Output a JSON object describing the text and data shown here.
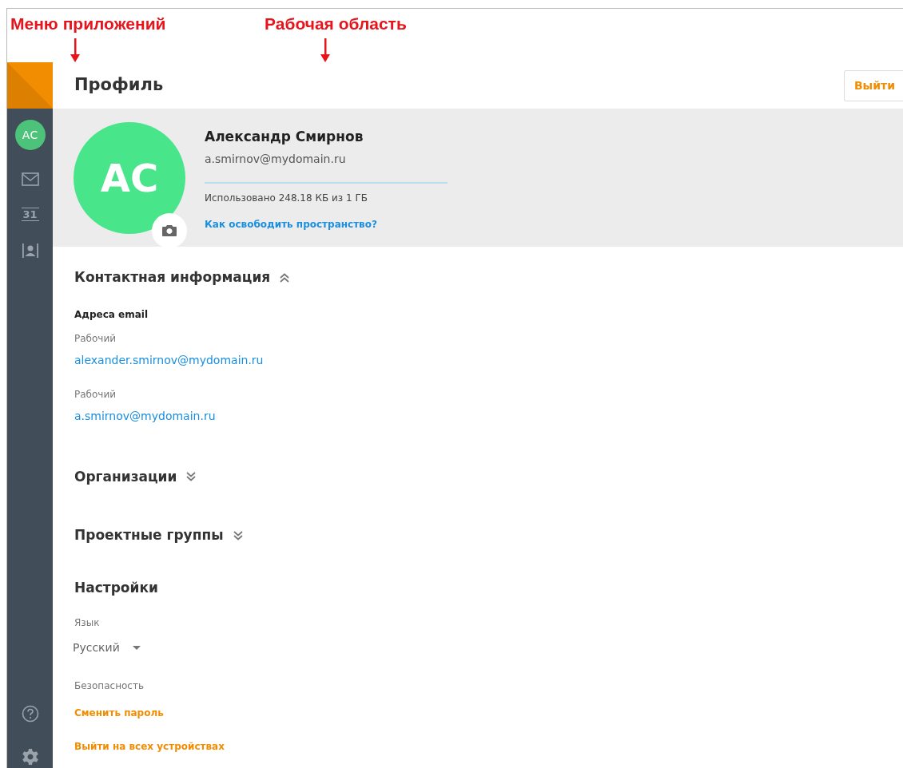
{
  "annotations": [
    {
      "label": "Меню приложений"
    },
    {
      "label": "Рабочая область"
    }
  ],
  "sidebar": {
    "items": [
      {
        "kind": "avatar",
        "initials": "АС"
      },
      {
        "kind": "mail"
      },
      {
        "kind": "calendar",
        "label": "31"
      },
      {
        "kind": "contacts"
      }
    ],
    "bottom_items": [
      {
        "kind": "help"
      },
      {
        "kind": "settings"
      }
    ]
  },
  "header": {
    "title": "Профиль",
    "logout_button": "Выйти"
  },
  "profile": {
    "initials": "АС",
    "name": "Александр Смирнов",
    "email": "a.smirnov@mydomain.ru",
    "storage": {
      "level": 0,
      "text": "Использовано 248.18 КБ из 1 ГБ"
    },
    "free_space_link": "Как освободить пространство?"
  },
  "sections": [
    {
      "title": "Контактная информация",
      "expanded": true,
      "kind": "contacts",
      "subtitle": "Адреса email",
      "emails": [
        {
          "label": "Рабочий",
          "address": "alexander.smirnov@mydomain.ru"
        },
        {
          "label": "Рабочий",
          "address": "a.smirnov@mydomain.ru"
        }
      ]
    },
    {
      "title": "Организации",
      "expanded": false,
      "kind": "collapsible"
    },
    {
      "title": "Проектные группы",
      "expanded": false,
      "kind": "collapsible"
    },
    {
      "title": "Настройки",
      "kind": "settings",
      "language_label": "Язык",
      "language": "Русский",
      "security_label": "Безопасность",
      "links": [
        "Сменить пароль",
        "Выйти на всех устройствах"
      ]
    }
  ]
}
